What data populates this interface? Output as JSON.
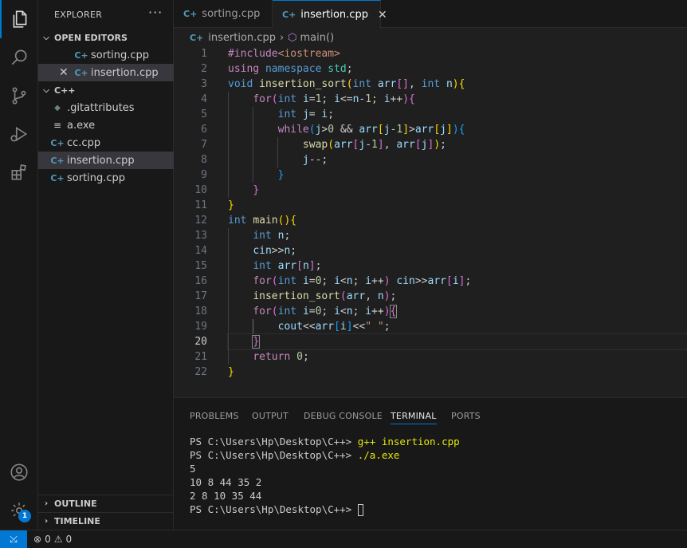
{
  "sidebar": {
    "title": "EXPLORER",
    "more": "···",
    "open_editors": {
      "header": "OPEN EDITORS",
      "items": [
        {
          "label": "sorting.cpp"
        },
        {
          "label": "insertion.cpp"
        }
      ]
    },
    "folder": {
      "header": "C++",
      "items": [
        {
          "label": ".gitattributes",
          "icon": "diamond-icon"
        },
        {
          "label": "a.exe",
          "icon": "lines-icon"
        },
        {
          "label": "cc.cpp",
          "icon": "cpp-icon"
        },
        {
          "label": "insertion.cpp",
          "icon": "cpp-icon"
        },
        {
          "label": "sorting.cpp",
          "icon": "cpp-icon"
        }
      ]
    },
    "outline": "OUTLINE",
    "timeline": "TIMELINE"
  },
  "tabs": [
    {
      "label": "sorting.cpp"
    },
    {
      "label": "insertion.cpp"
    }
  ],
  "breadcrumb": {
    "file": "insertion.cpp",
    "symbol": "main()"
  },
  "editor": {
    "line_numbers": [
      "1",
      "2",
      "3",
      "4",
      "5",
      "6",
      "7",
      "8",
      "9",
      "10",
      "11",
      "12",
      "13",
      "14",
      "15",
      "16",
      "17",
      "18",
      "19",
      "20",
      "21",
      "22"
    ],
    "current_line": "20"
  },
  "panel": {
    "tabs": [
      "PROBLEMS",
      "OUTPUT",
      "DEBUG CONSOLE",
      "TERMINAL",
      "PORTS"
    ],
    "active_tab": "TERMINAL",
    "terminal": {
      "prompt": "PS C:\\Users\\Hp\\Desktop\\C++> ",
      "cmd1": "g++ insertion.cpp",
      "cmd2": "./a.exe",
      "out1": "5",
      "out2": "10 8 44 35 2",
      "out3": "2 8 10 35 44"
    }
  },
  "status": {
    "errors": "0",
    "warnings": "0"
  },
  "activity": {
    "badge": "1"
  },
  "colors": {
    "accent": "#0078d4",
    "background": "#1f1f1f",
    "sidebar": "#181818"
  }
}
